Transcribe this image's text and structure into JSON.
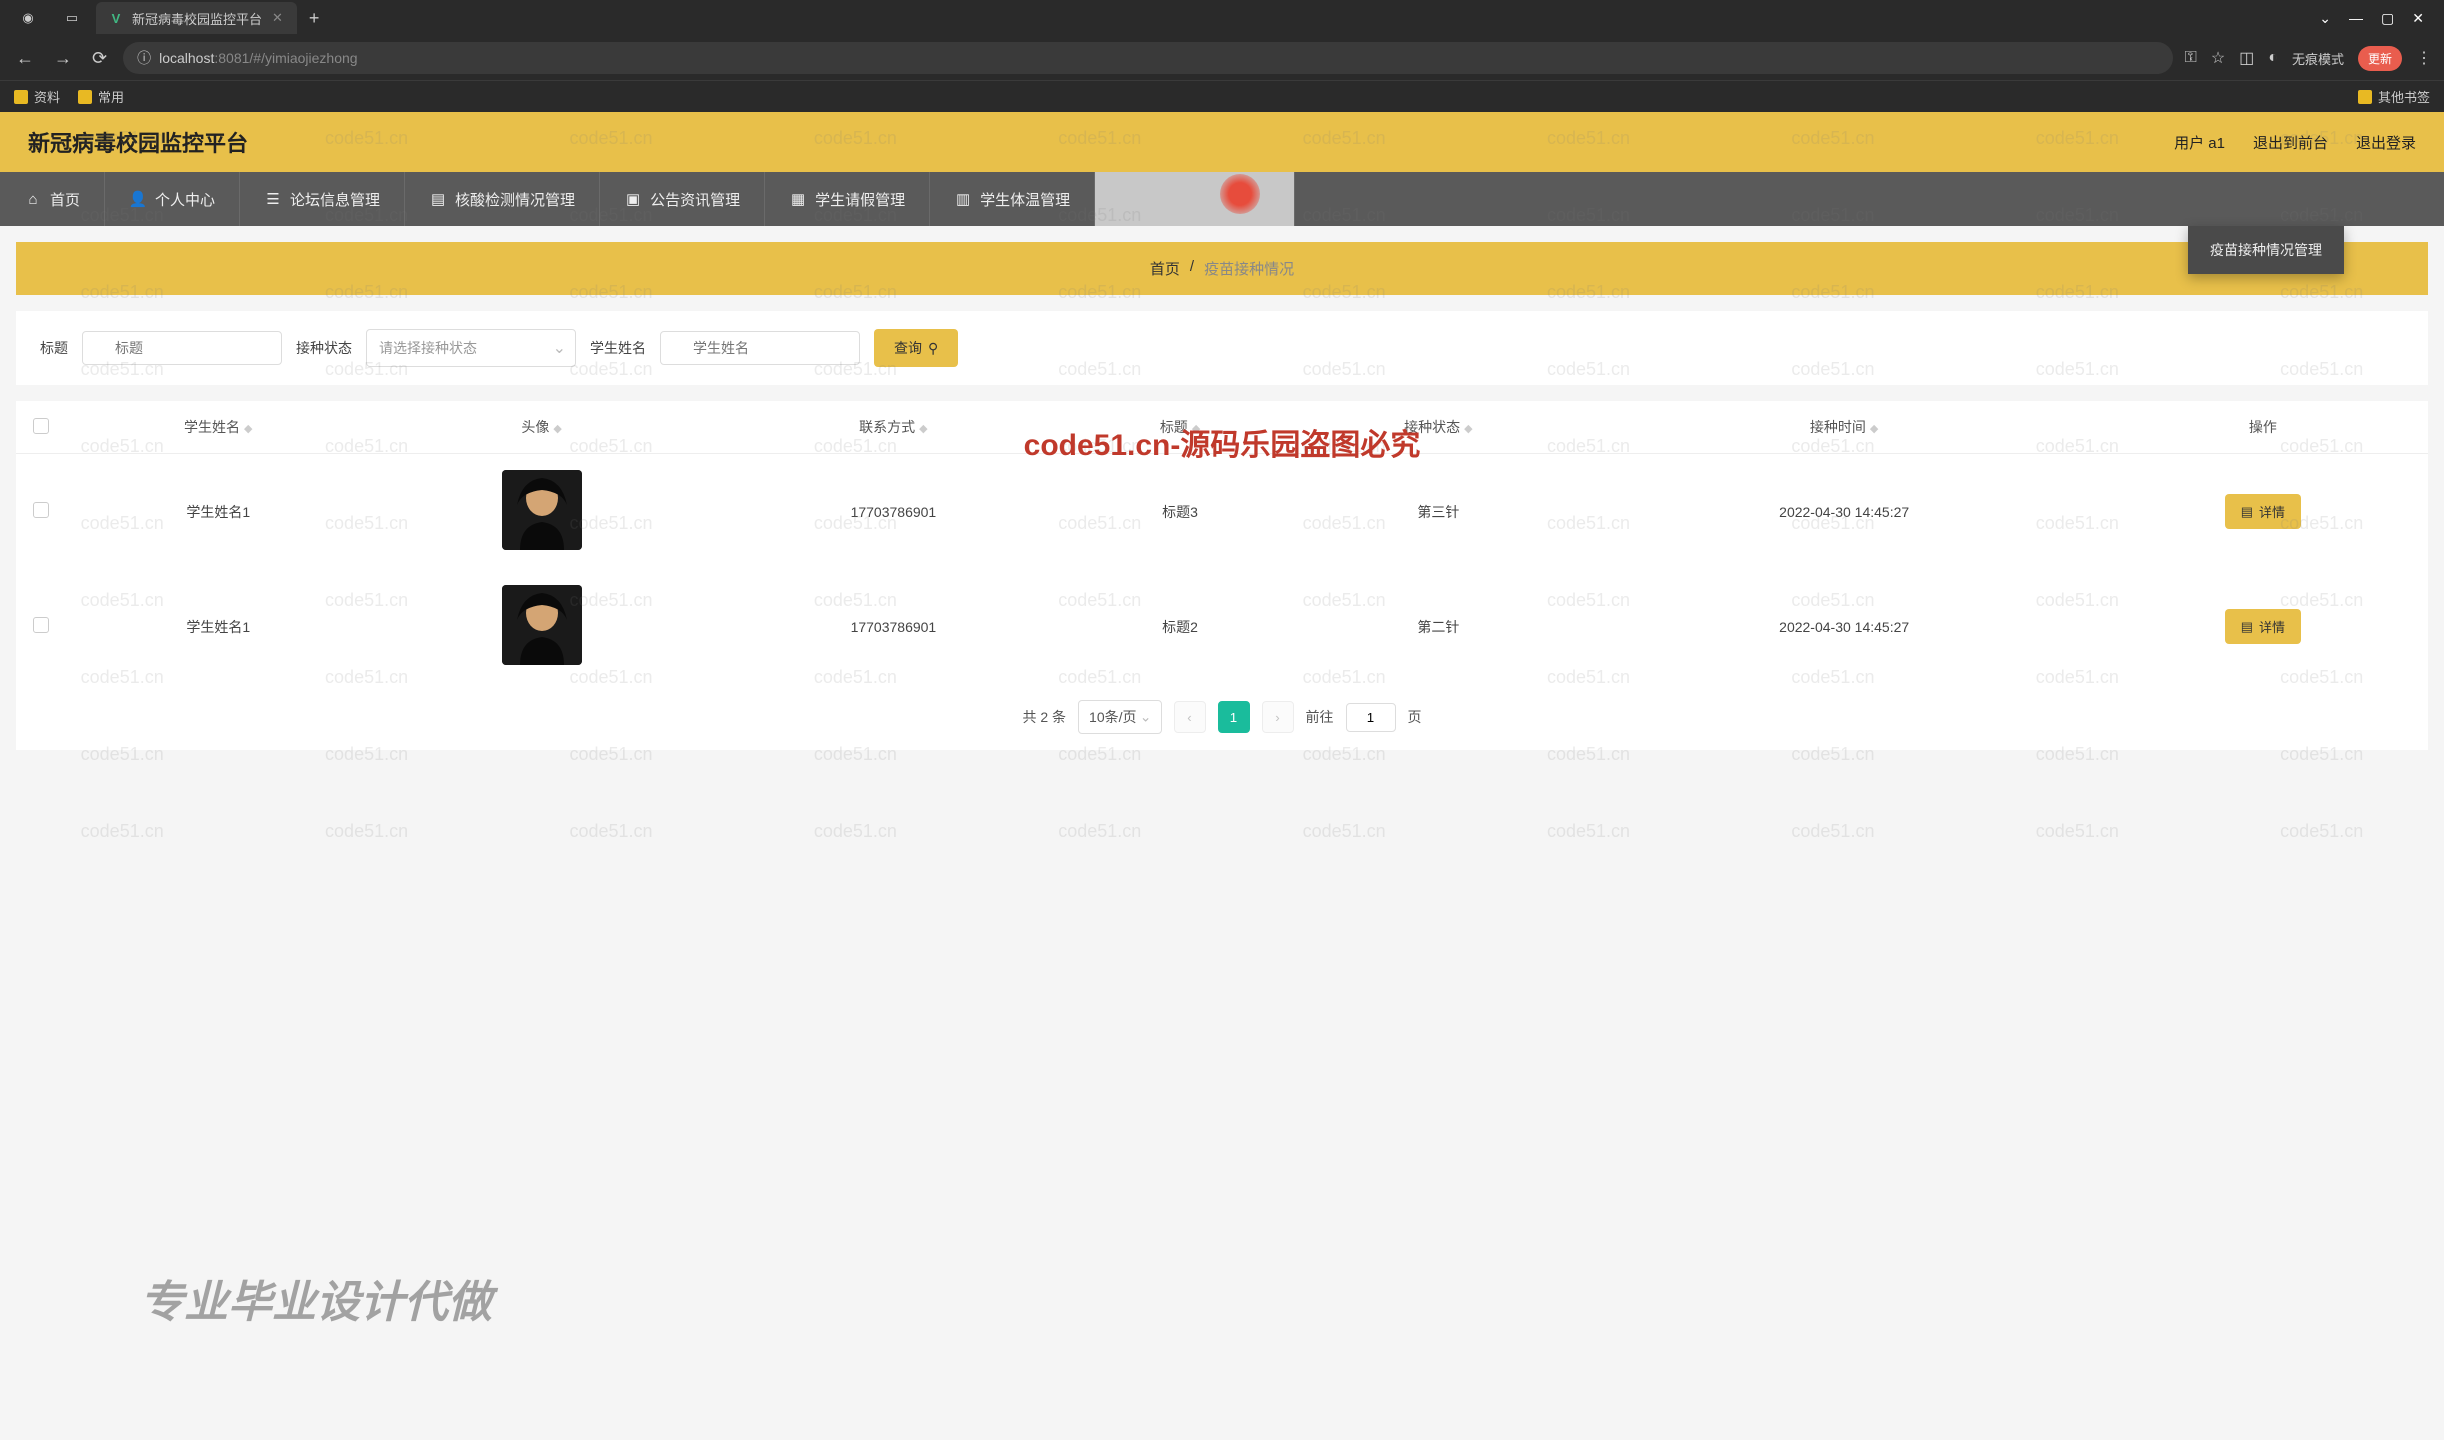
{
  "browser": {
    "tab_title": "新冠病毒校园监控平台",
    "url_host": "localhost",
    "url_port": ":8081",
    "url_path": "/#/yimiaojiezhong",
    "incognito_label": "无痕模式",
    "update_label": "更新",
    "bookmarks": [
      "资料",
      "常用"
    ],
    "bookmark_other": "其他书签"
  },
  "header": {
    "title": "新冠病毒校园监控平台",
    "user_label": "用户 a1",
    "logout_front": "退出到前台",
    "logout": "退出登录"
  },
  "nav": {
    "items": [
      {
        "label": "首页",
        "icon": "home"
      },
      {
        "label": "个人中心",
        "icon": "user"
      },
      {
        "label": "论坛信息管理",
        "icon": "list"
      },
      {
        "label": "核酸检测情况管理",
        "icon": "doc"
      },
      {
        "label": "公告资讯管理",
        "icon": "bell"
      },
      {
        "label": "学生请假管理",
        "icon": "calendar"
      },
      {
        "label": "学生体温管理",
        "icon": "thermo"
      }
    ],
    "dropdown_label": "疫苗接种情况管理"
  },
  "breadcrumb": {
    "home": "首页",
    "sep": "/",
    "current": "疫苗接种情况"
  },
  "filters": {
    "title_label": "标题",
    "title_placeholder": "标题",
    "status_label": "接种状态",
    "status_placeholder": "请选择接种状态",
    "name_label": "学生姓名",
    "name_placeholder": "学生姓名",
    "search_btn": "查询"
  },
  "table": {
    "headers": [
      "学生姓名",
      "头像",
      "联系方式",
      "标题",
      "接种状态",
      "接种时间",
      "操作"
    ],
    "detail_btn": "详情",
    "rows": [
      {
        "name": "学生姓名1",
        "phone": "17703786901",
        "title": "标题3",
        "status": "第三针",
        "time": "2022-04-30 14:45:27"
      },
      {
        "name": "学生姓名1",
        "phone": "17703786901",
        "title": "标题2",
        "status": "第二针",
        "time": "2022-04-30 14:45:27"
      }
    ]
  },
  "pagination": {
    "total_label": "共 2 条",
    "page_size": "10条/页",
    "current_page": "1",
    "goto_label": "前往",
    "goto_value": "1",
    "page_suffix": "页"
  },
  "watermarks": {
    "repeat": "code51.cn",
    "center": "code51.cn-源码乐园盗图必究",
    "bottom": "专业毕业设计代做"
  }
}
